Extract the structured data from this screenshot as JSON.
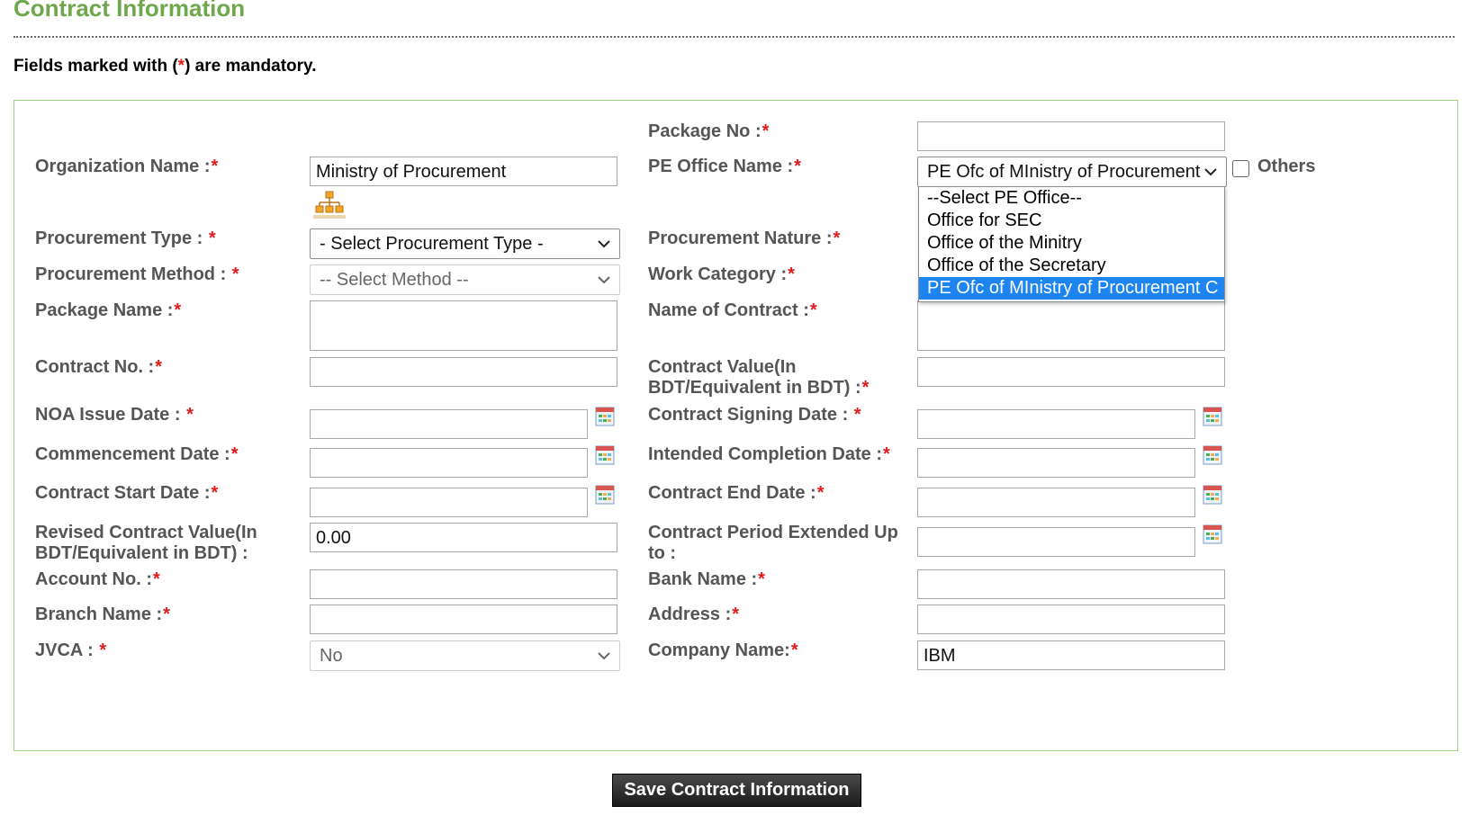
{
  "page": {
    "title": "Contract Information",
    "mandatory_prefix": "Fields marked with (",
    "mandatory_star": "*",
    "mandatory_suffix": ") are mandatory."
  },
  "labels": {
    "package_no": "Package No :",
    "organization_name": "Organization Name :",
    "pe_office_name": "PE Office Name :",
    "others": "Others",
    "procurement_type": "Procurement Type : ",
    "procurement_nature": "Procurement Nature :",
    "procurement_method": "Procurement Method : ",
    "work_category": "Work Category :",
    "package_name": "Package Name :",
    "name_of_contract": "Name of Contract :",
    "contract_no": "Contract No. :",
    "contract_value_line1": "Contract Value(In",
    "contract_value_line2": "BDT/Equivalent in BDT) :",
    "noa_issue_date": "NOA Issue Date : ",
    "contract_signing_date": "Contract Signing Date : ",
    "commencement_date": "Commencement Date :",
    "intended_completion_date": "Intended Completion Date :",
    "contract_start_date": "Contract Start Date :",
    "contract_end_date": "Contract End Date :",
    "revised_value_line1": "Revised Contract Value(In",
    "revised_value_line2": "BDT/Equivalent in BDT) :",
    "period_extended_line1": "Contract Period Extended Up",
    "period_extended_line2": "to :",
    "account_no": "Account No. :",
    "bank_name": "Bank Name :",
    "branch_name": "Branch Name :",
    "address": "Address :",
    "jvca": "JVCA : ",
    "company_name": "Company Name:",
    "required_mark": "*"
  },
  "fields": {
    "package_no": "",
    "organization_name": "Ministry of Procurement",
    "pe_office_selected": "PE Ofc of MInistry of Procurement",
    "procurement_type_selected": "- Select Procurement Type -",
    "procurement_method_selected": "-- Select Method --",
    "package_name": "",
    "name_of_contract": "",
    "contract_no": "",
    "contract_value": "",
    "noa_issue_date": "",
    "contract_signing_date": "",
    "commencement_date": "",
    "intended_completion_date": "",
    "contract_start_date": "",
    "contract_end_date": "",
    "revised_contract_value": "0.00",
    "contract_period_extended": "",
    "account_no": "",
    "bank_name": "",
    "branch_name": "",
    "address": "",
    "jvca_selected": "No",
    "company_name": "IBM"
  },
  "pe_office_options": [
    "--Select PE Office--",
    "Office for SEC",
    "Office of the Minitry",
    "Office of the Secretary",
    "PE Ofc of MInistry of Procurement C"
  ],
  "buttons": {
    "save": "Save Contract Information"
  },
  "colors": {
    "title_green": "#6ea84a",
    "panel_border": "#9fd17f",
    "required_red": "#e01b1b",
    "highlight_blue": "#1e84f0"
  },
  "icons": {
    "org_tree": "org-tree-icon",
    "calendar": "calendar-icon",
    "dropdown": "chevron-down-icon"
  }
}
